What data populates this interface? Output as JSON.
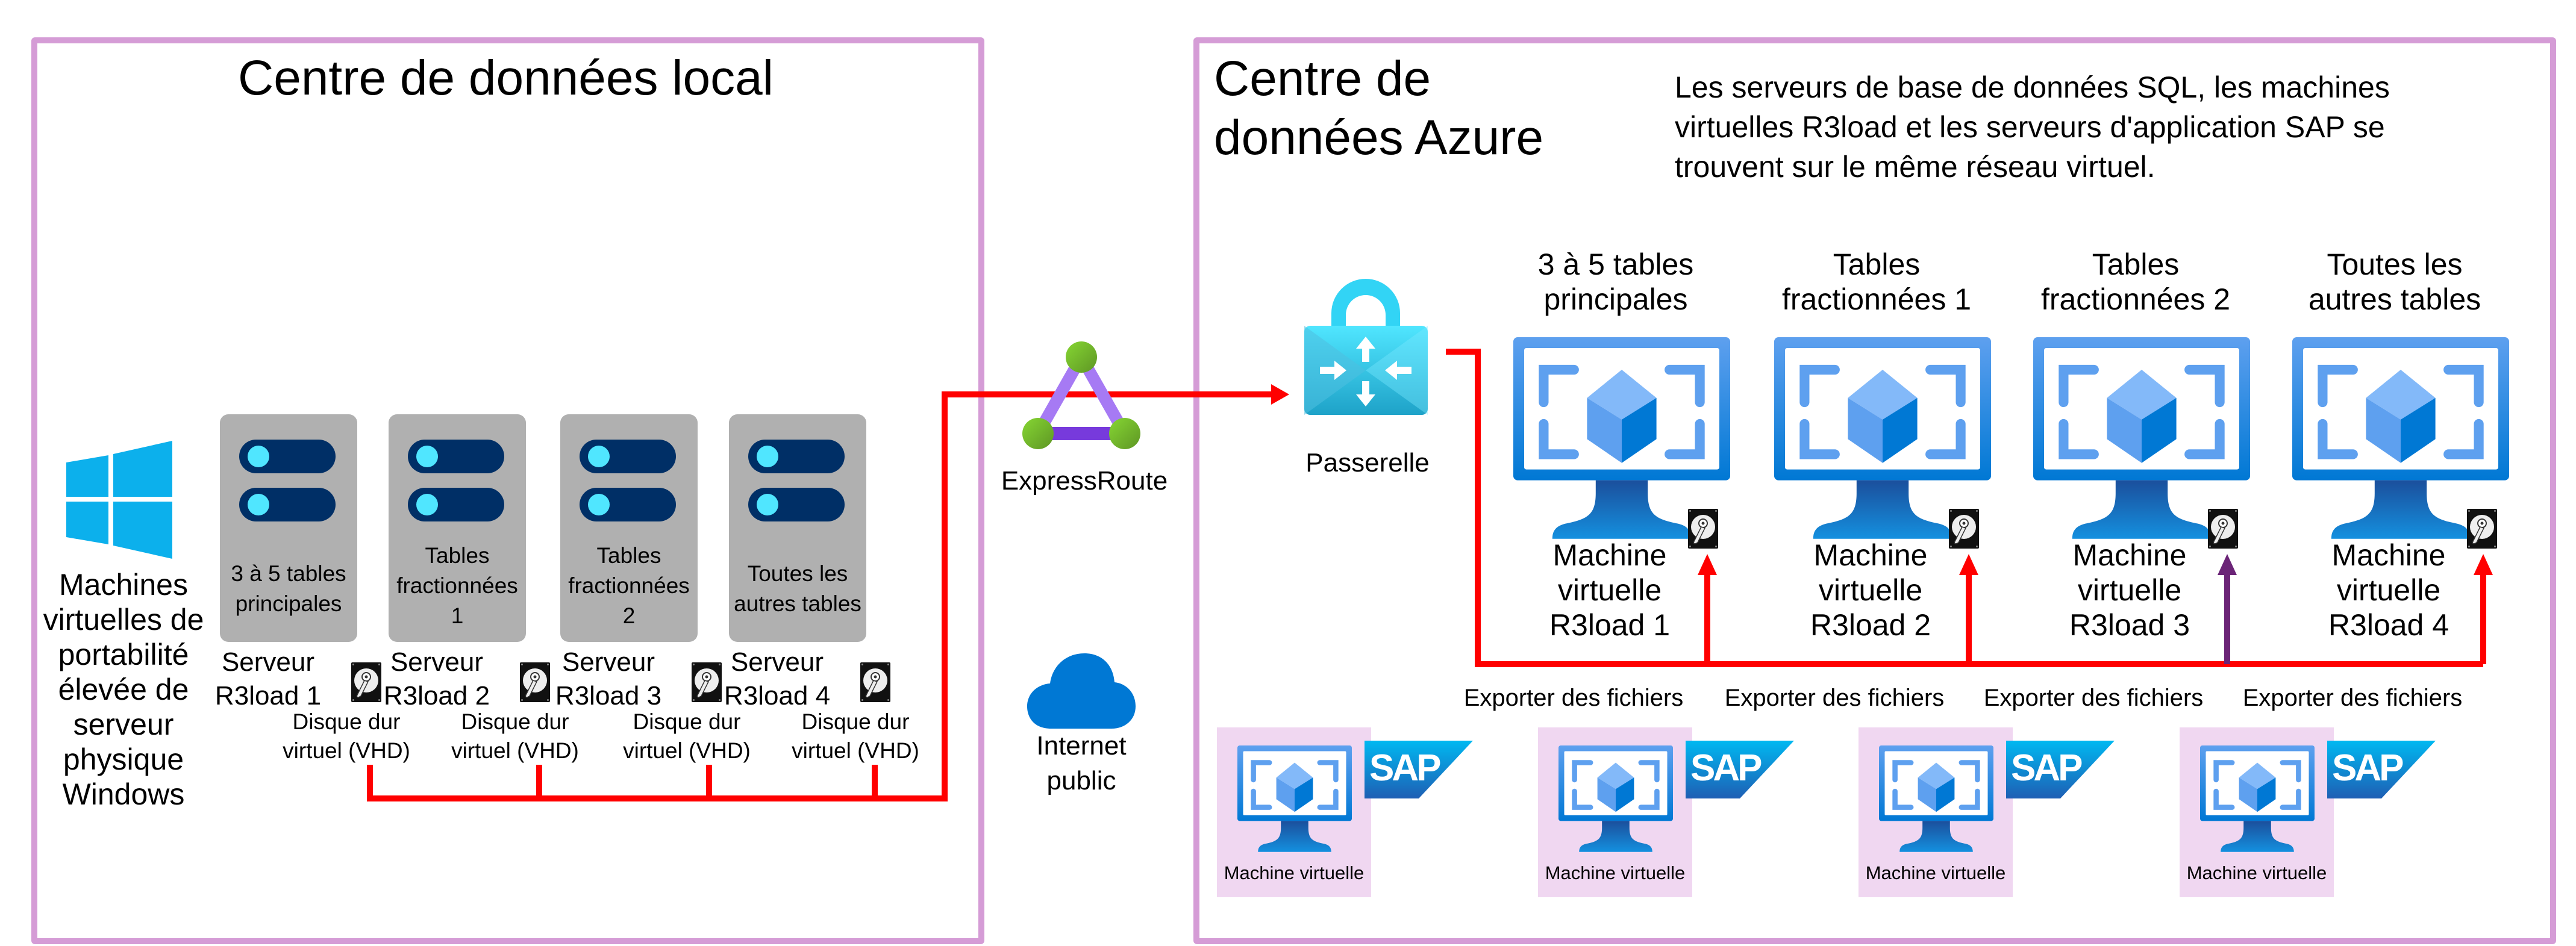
{
  "on_prem": {
    "title": "Centre de données local",
    "windows_label": [
      "Machines",
      "virtuelles de",
      "portabilité",
      "élevée de",
      "serveur",
      "physique",
      "Windows"
    ],
    "servers": [
      {
        "card_text": [
          "3 à 5 tables",
          "principales"
        ],
        "name": [
          "Serveur",
          "R3load 1"
        ],
        "disk": [
          "Disque dur",
          "virtuel (VHD)"
        ]
      },
      {
        "card_text": [
          "Tables",
          "fractionnées",
          "1"
        ],
        "name": [
          "Serveur",
          "R3load 2"
        ],
        "disk": [
          "Disque dur",
          "virtuel (VHD)"
        ]
      },
      {
        "card_text": [
          "Tables",
          "fractionnées",
          "2"
        ],
        "name": [
          "Serveur",
          "R3load 3"
        ],
        "disk": [
          "Disque dur",
          "virtuel (VHD)"
        ]
      },
      {
        "card_text": [
          "Toutes les",
          "autres tables"
        ],
        "name": [
          "Serveur",
          "R3load 4"
        ],
        "disk": [
          "Disque dur",
          "virtuel (VHD)"
        ]
      }
    ]
  },
  "middle": {
    "expressroute_label": "ExpressRoute",
    "internet_label": [
      "Internet",
      "public"
    ]
  },
  "azure": {
    "title": [
      "Centre de",
      "données Azure"
    ],
    "note": [
      "Les serveurs de base de données SQL, les machines",
      "virtuelles R3load et les serveurs d'application SAP se",
      "trouvent sur le même réseau virtuel."
    ],
    "gateway_label": "Passerelle",
    "vms": [
      {
        "header": [
          "3 à 5 tables",
          "principales"
        ],
        "name": [
          "Machine",
          "virtuelle",
          "R3load 1"
        ],
        "export": "Exporter des fichiers",
        "arrow_color": "#ff0000"
      },
      {
        "header": [
          "Tables",
          "fractionnées 1"
        ],
        "name": [
          "Machine",
          "virtuelle",
          "R3load 2"
        ],
        "export": "Exporter des fichiers",
        "arrow_color": "#ff0000"
      },
      {
        "header": [
          "Tables",
          "fractionnées 2"
        ],
        "name": [
          "Machine",
          "virtuelle",
          "R3load 3"
        ],
        "export": "Exporter des fichiers",
        "arrow_color": "#6b2477"
      },
      {
        "header": [
          "Toutes les",
          "autres tables"
        ],
        "name": [
          "Machine",
          "virtuelle",
          "R3load 4"
        ],
        "export": "Exporter des fichiers",
        "arrow_color": "#ff0000"
      }
    ],
    "sap_vms": [
      {
        "label": "Machine virtuelle",
        "badge": "SAP"
      },
      {
        "label": "Machine virtuelle",
        "badge": "SAP"
      },
      {
        "label": "Machine virtuelle",
        "badge": "SAP"
      },
      {
        "label": "Machine virtuelle",
        "badge": "SAP"
      }
    ]
  },
  "colors": {
    "frame": "#d59cd6",
    "connector": "#ff0000",
    "connector_alt": "#6b2477",
    "azure_blue": "#0078d4",
    "sap_bg": "#f0d7f1"
  }
}
